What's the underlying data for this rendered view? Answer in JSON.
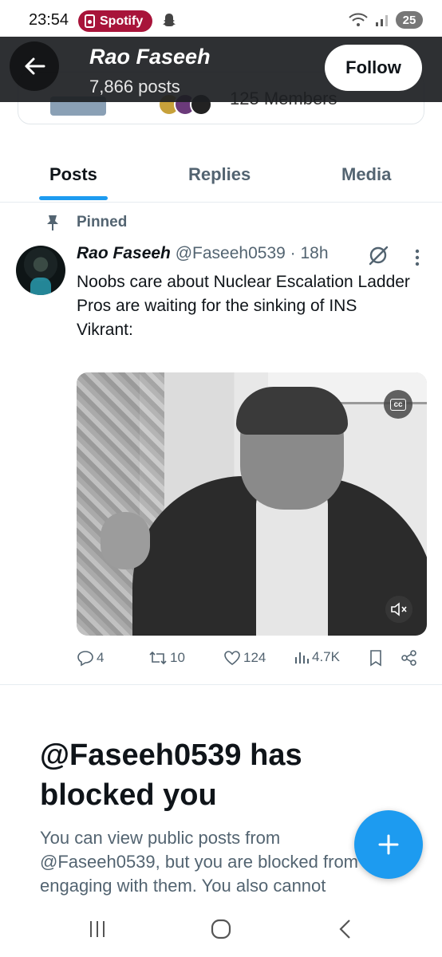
{
  "status_bar": {
    "time": "23:54",
    "spotify_label": "Spotify",
    "battery": "25",
    "icons": [
      "snapchat-icon",
      "wifi-icon",
      "signal-icon",
      "battery-icon"
    ]
  },
  "header": {
    "name": "Rao Faseeh",
    "posts_count": "7,866 posts",
    "follow_label": "Follow",
    "underlay_text": "125 Members"
  },
  "tabs": [
    {
      "label": "Posts",
      "active": true
    },
    {
      "label": "Replies",
      "active": false
    },
    {
      "label": "Media",
      "active": false
    }
  ],
  "post": {
    "pinned_label": "Pinned",
    "name": "Rao Faseeh",
    "meta": "@Faseeh0539 · 18h",
    "text_line1": "Noobs care about Nuclear Escalation Ladder",
    "text_line2": "Pros are waiting for the sinking of INS Vikrant:",
    "cc_label": "cc",
    "actions": {
      "replies": "4",
      "reposts": "10",
      "likes": "124",
      "views": "4.7K"
    }
  },
  "blocked": {
    "title": "@Faseeh0539 has blocked you",
    "description": "You can view public posts from @Faseeh0539, but you are blocked from engaging with them. You also cannot"
  },
  "colors": {
    "accent": "#1d9bf0",
    "text_primary": "#0f1419",
    "text_secondary": "#536471",
    "spotify_pill": "#a8143a"
  }
}
